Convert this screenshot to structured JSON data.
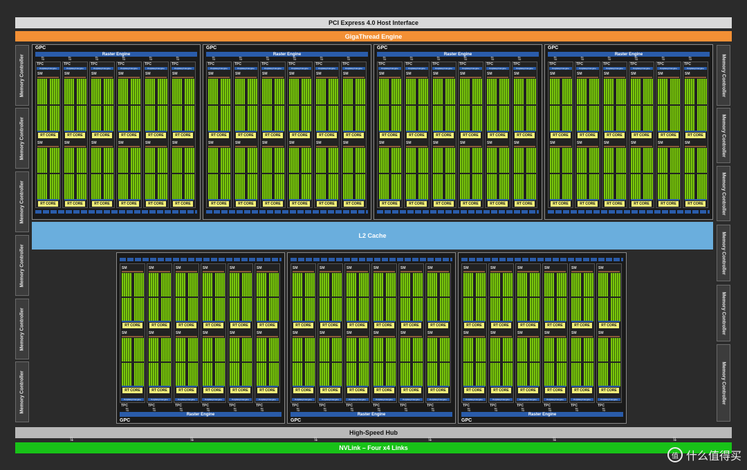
{
  "pcie": "PCI Express 4.0 Host Interface",
  "gigathread": "GigaThread Engine",
  "l2": "L2 Cache",
  "hub": "High-Speed Hub",
  "nvlink": "NVLink – Four x4 Links",
  "memory_controller": "Memory Controller",
  "gpc_label": "GPC",
  "raster_engine": "Raster Engine",
  "tpc_label": "TPC",
  "polymorph": "PolyMorph Engine",
  "sm_label": "SM",
  "rt_core": "RT CORE",
  "arrow": "⇅",
  "watermark": {
    "badge": "值",
    "text": "什么值得买"
  }
}
